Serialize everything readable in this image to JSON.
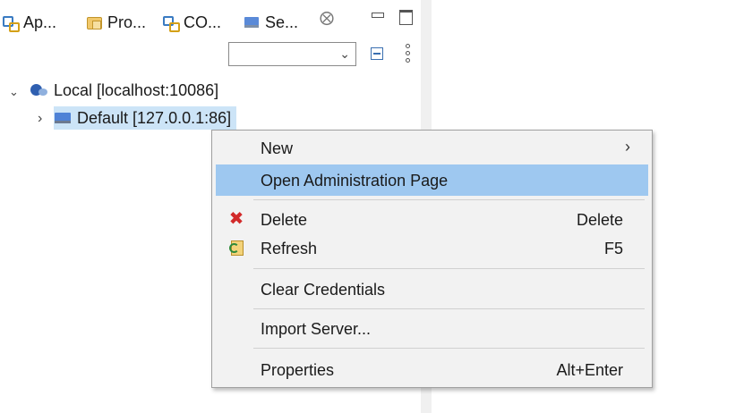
{
  "tabs": [
    {
      "label": "Ap...",
      "icon": "app-icon"
    },
    {
      "label": "Pro...",
      "icon": "project-icon"
    },
    {
      "label": "CO...",
      "icon": "co-icon"
    },
    {
      "label": "Se...",
      "icon": "servers-icon",
      "active": true
    }
  ],
  "tab_close_glyph": "⨂",
  "tree": {
    "root": {
      "label": "Local [localhost:10086]",
      "expanded": true,
      "icon": "elasticsearch-icon"
    },
    "child": {
      "label": "Default [127.0.0.1:86]",
      "expanded": false,
      "selected": true,
      "icon": "server-icon"
    }
  },
  "context_menu": {
    "items": [
      {
        "label": "New",
        "has_submenu": true
      },
      {
        "label": "Open Administration Page",
        "highlighted": true
      },
      {
        "label": "Delete",
        "accelerator": "Delete",
        "icon": "delete-icon"
      },
      {
        "label": "Refresh",
        "accelerator": "F5",
        "icon": "refresh-icon"
      },
      {
        "label": "Clear Credentials"
      },
      {
        "label": "Import Server..."
      },
      {
        "label": "Properties",
        "accelerator": "Alt+Enter"
      }
    ]
  },
  "colors": {
    "selection": "#cce4f7",
    "menu_highlight": "#9ec8f0",
    "menu_background": "#f2f2f2",
    "delete_icon": "#d22a2a"
  }
}
